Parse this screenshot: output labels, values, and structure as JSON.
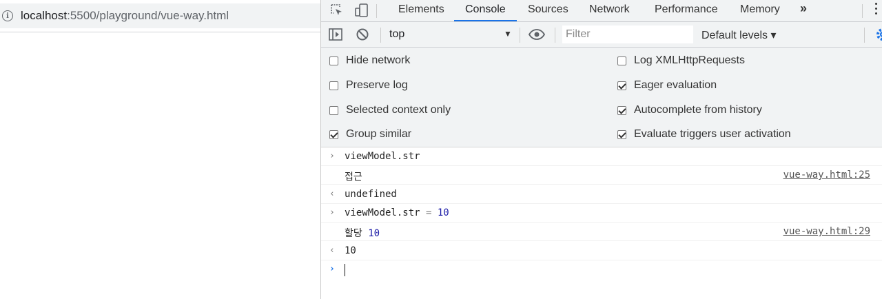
{
  "page": {
    "url_host": "localhost",
    "url_rest": ":5500/playground/vue-way.html"
  },
  "devtools": {
    "tabs": [
      "Elements",
      "Console",
      "Sources",
      "Network",
      "Performance",
      "Memory"
    ],
    "active_tab": "Console",
    "more_tabs_label": "»",
    "toolbar": {
      "context": "top",
      "filter_placeholder": "Filter",
      "filter_value": "",
      "levels": "Default levels ▾"
    },
    "settings": {
      "left": [
        {
          "label": "Hide network",
          "checked": false
        },
        {
          "label": "Preserve log",
          "checked": false
        },
        {
          "label": "Selected context only",
          "checked": false
        },
        {
          "label": "Group similar",
          "checked": true
        }
      ],
      "right": [
        {
          "label": "Log XMLHttpRequests",
          "checked": false
        },
        {
          "label": "Eager evaluation",
          "checked": true
        },
        {
          "label": "Autocomplete from history",
          "checked": true
        },
        {
          "label": "Evaluate triggers user activation",
          "checked": true
        }
      ]
    },
    "console": {
      "rows": [
        {
          "kind": "input",
          "text": "viewModel.str"
        },
        {
          "kind": "log",
          "text": "접근",
          "source": "vue-way.html:25"
        },
        {
          "kind": "result",
          "text": "undefined"
        },
        {
          "kind": "input",
          "text": "viewModel.str",
          "op": " = ",
          "value": "10"
        },
        {
          "kind": "log",
          "text": "할당 ",
          "value": "10",
          "source": "vue-way.html:29"
        },
        {
          "kind": "result",
          "value": "10"
        }
      ],
      "prompt_glyph": "›",
      "input_glyph": "›",
      "result_glyph": "‹"
    }
  },
  "colors": {
    "accent": "#1a73e8",
    "number": "#1a1aa6",
    "panel_bg": "#f1f3f4"
  }
}
